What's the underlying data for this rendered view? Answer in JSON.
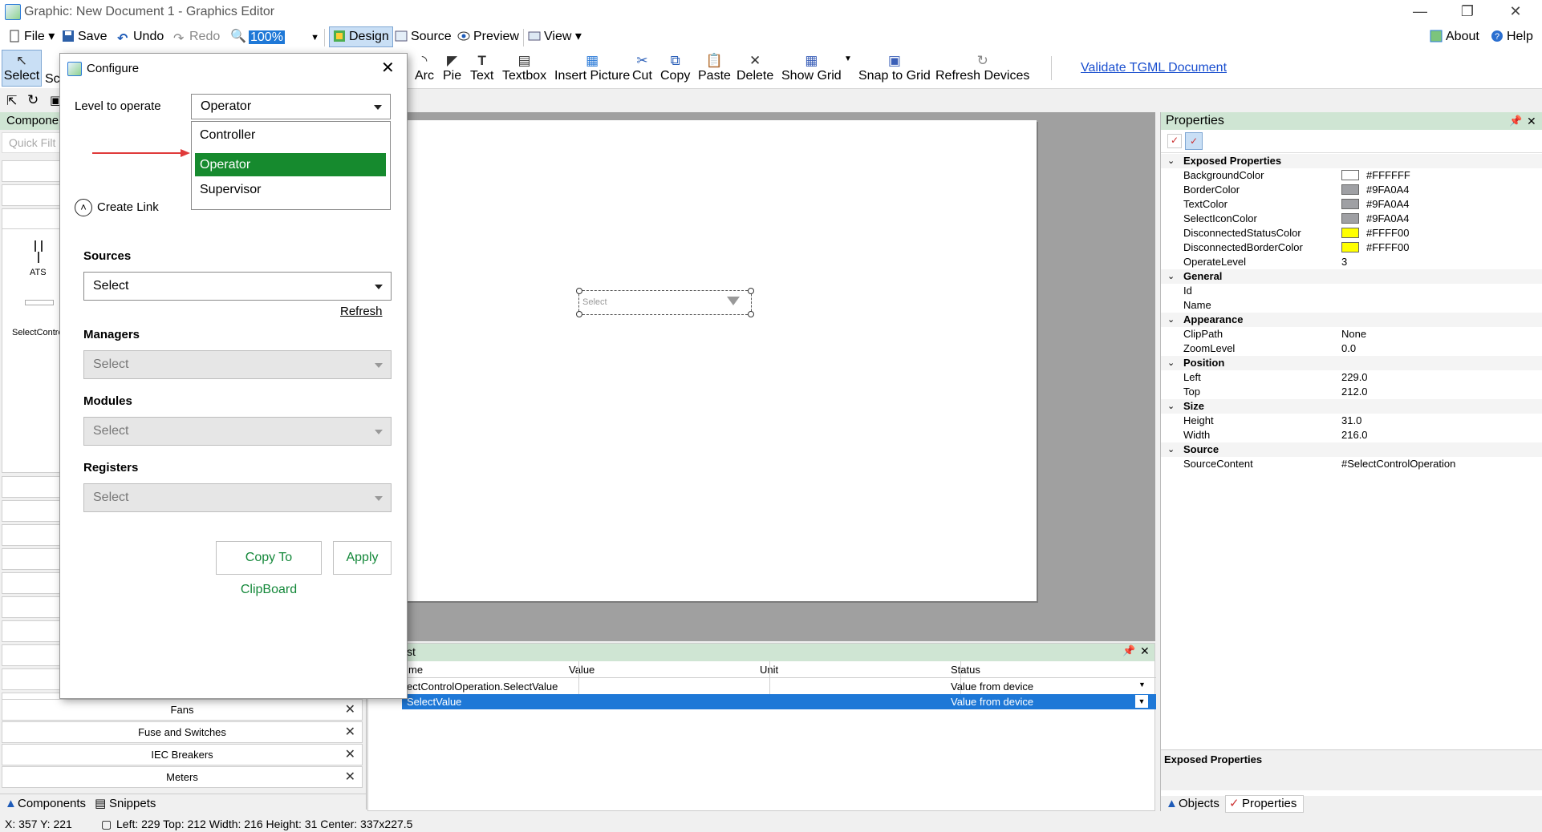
{
  "window": {
    "title": "Graphic: New Document 1 - Graphics Editor"
  },
  "toolbar1": {
    "file": "File",
    "save": "Save",
    "undo": "Undo",
    "redo": "Redo",
    "zoom": "100%",
    "design": "Design",
    "source": "Source",
    "preview": "Preview",
    "view": "View",
    "about": "About",
    "help": "Help"
  },
  "toolbar2": {
    "select": "Select",
    "select_trunc": "Sc",
    "tools": [
      "Arc",
      "Pie",
      "Text",
      "Textbox",
      "Insert Picture",
      "Cut",
      "Copy",
      "Paste",
      "Delete",
      "Show Grid",
      "Snap to Grid",
      "Refresh Devices"
    ],
    "validate": "Validate TGML Document"
  },
  "left_panel": {
    "components_title": "Compone",
    "quick_filter": "Quick Filt",
    "component_ats": "ATS",
    "component_select": "SelectContro",
    "categories": [
      "Fans",
      "Fuse and Switches",
      "IEC Breakers",
      "Meters"
    ],
    "tabs": {
      "components": "Components",
      "snippets": "Snippets"
    }
  },
  "dialog": {
    "title": "Configure",
    "level_label": "Level to operate",
    "level_value": "Operator",
    "options": [
      "Controller",
      "Operator",
      "Supervisor"
    ],
    "create_link": "Create Link",
    "sources_label": "Sources",
    "sources_value": "Select",
    "refresh": "Refresh",
    "managers_label": "Managers",
    "managers_value": "Select",
    "modules_label": "Modules",
    "modules_value": "Select",
    "registers_label": "Registers",
    "registers_value": "Select",
    "copy_button": "Copy To ClipBoard",
    "apply_button": "Apply"
  },
  "canvas": {
    "widget_text": "Select"
  },
  "bindings": {
    "title": "st",
    "columns": [
      "me",
      "Value",
      "Unit",
      "Status"
    ],
    "rows": [
      {
        "name": "ectControlOperation.SelectValue",
        "value": "",
        "unit": "",
        "status": "Value from device"
      },
      {
        "name": "SelectValue",
        "value": "",
        "unit": "",
        "status": "Value from device"
      }
    ]
  },
  "properties": {
    "title": "Properties",
    "categories": {
      "exposed": "Exposed Properties",
      "general": "General",
      "appearance": "Appearance",
      "position": "Position",
      "size": "Size",
      "source": "Source"
    },
    "exposed": [
      {
        "name": "BackgroundColor",
        "value": "#FFFFFF",
        "color": "#FFFFFF"
      },
      {
        "name": "BorderColor",
        "value": "#9FA0A4",
        "color": "#9FA0A4"
      },
      {
        "name": "TextColor",
        "value": "#9FA0A4",
        "color": "#9FA0A4"
      },
      {
        "name": "SelectIconColor",
        "value": "#9FA0A4",
        "color": "#9FA0A4"
      },
      {
        "name": "DisconnectedStatusColor",
        "value": "#FFFF00",
        "color": "#FFFF00"
      },
      {
        "name": "DisconnectedBorderColor",
        "value": "#FFFF00",
        "color": "#FFFF00"
      }
    ],
    "operate_level": {
      "name": "OperateLevel",
      "value": "3"
    },
    "general": [
      {
        "name": "Id",
        "value": ""
      },
      {
        "name": "Name",
        "value": ""
      }
    ],
    "appearance": [
      {
        "name": "ClipPath",
        "value": "None"
      },
      {
        "name": "ZoomLevel",
        "value": "0.0"
      }
    ],
    "position": [
      {
        "name": "Left",
        "value": "229.0"
      },
      {
        "name": "Top",
        "value": "212.0"
      }
    ],
    "size": [
      {
        "name": "Height",
        "value": "31.0"
      },
      {
        "name": "Width",
        "value": "216.0"
      }
    ],
    "source": [
      {
        "name": "SourceContent",
        "value": "#SelectControlOperation"
      }
    ],
    "description_title": "Exposed Properties",
    "tabs": {
      "objects": "Objects",
      "properties": "Properties"
    }
  },
  "status_bar": {
    "cursor": "X: 357  Y: 221",
    "selection": "Left: 229  Top: 212  Width: 216  Height: 31  Center: 337x227.5"
  },
  "colors": {
    "accent_green": "#168a2e",
    "selection_blue": "#1e78d7",
    "panel_header": "#cfe5d3"
  }
}
